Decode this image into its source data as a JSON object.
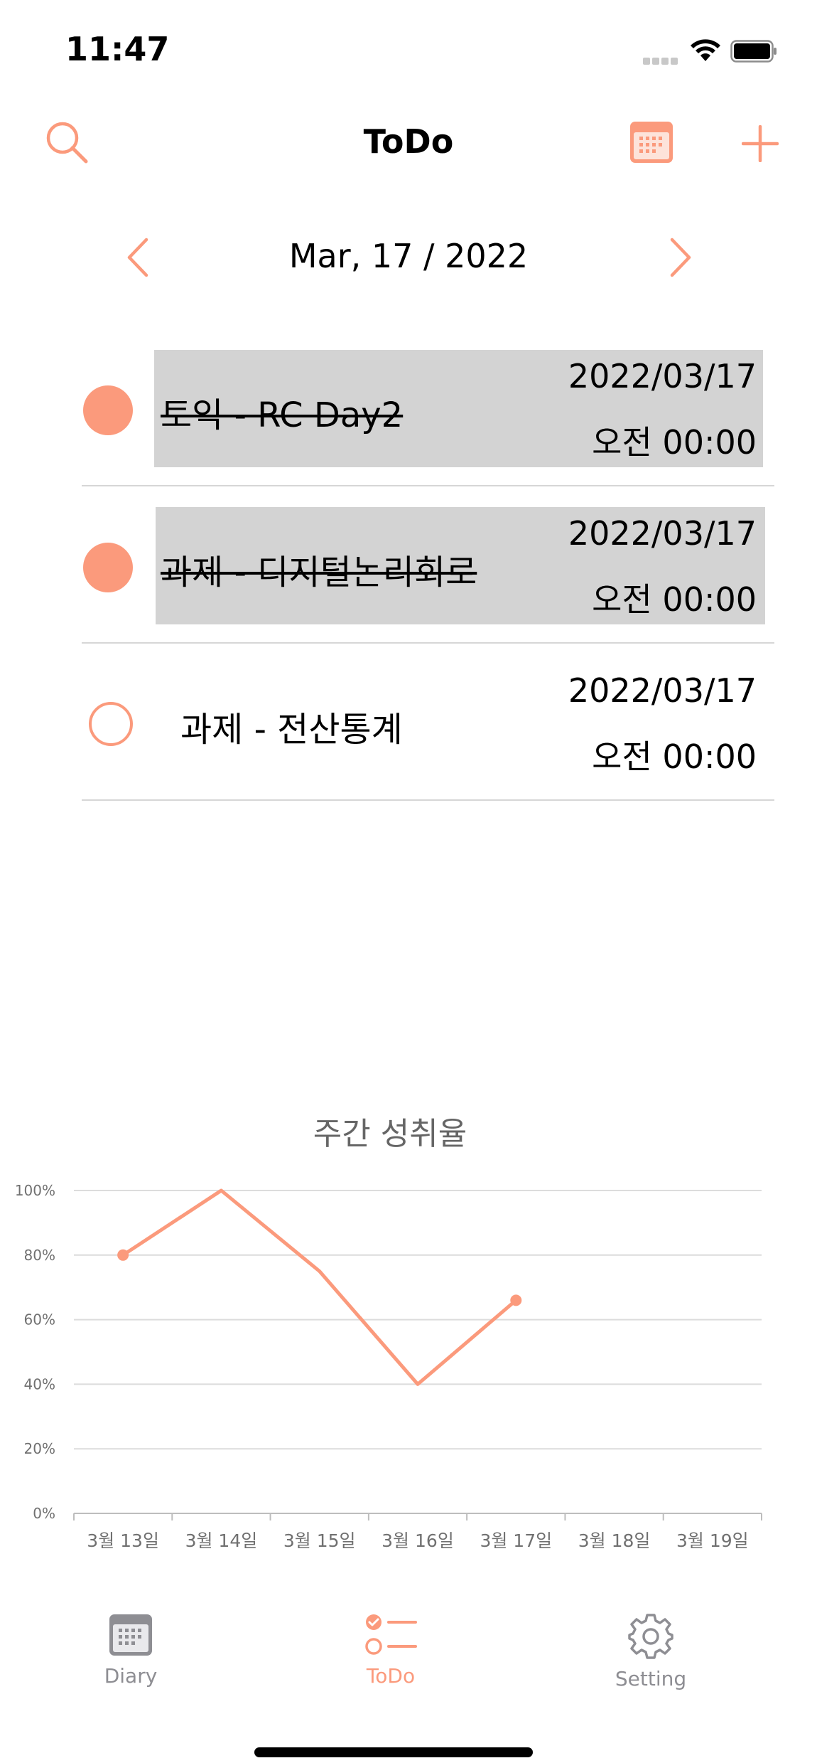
{
  "status_bar": {
    "time": "11:47"
  },
  "nav": {
    "title": "ToDo"
  },
  "date_nav": {
    "current": "Mar, 17 / 2022"
  },
  "todos": [
    {
      "title": "토익 - RC Day2",
      "date": "2022/03/17",
      "time": "오전 00:00",
      "done": true
    },
    {
      "title": "과제 - 디지털논리회로",
      "date": "2022/03/17",
      "time": "오전 00:00",
      "done": true
    },
    {
      "title": "과제 - 전산통계",
      "date": "2022/03/17",
      "time": "오전 00:00",
      "done": false
    }
  ],
  "chart_data": {
    "type": "line",
    "title": "주간 성취율",
    "categories": [
      "3월 13일",
      "3월 14일",
      "3월 15일",
      "3월 16일",
      "3월 17일",
      "3월 18일",
      "3월 19일"
    ],
    "series": [
      {
        "values": [
          80,
          100,
          75,
          40,
          66,
          null,
          null
        ]
      }
    ],
    "yticks": [
      "0%",
      "20%",
      "40%",
      "60%",
      "80%",
      "100%"
    ],
    "ylim": [
      0,
      100
    ],
    "grid": true,
    "color": "#fb9a7c"
  },
  "tabs": [
    {
      "label": "Diary",
      "icon": "calendar-icon",
      "active": false
    },
    {
      "label": "ToDo",
      "icon": "checklist-icon",
      "active": true
    },
    {
      "label": "Setting",
      "icon": "gear-icon",
      "active": false
    }
  ],
  "colors": {
    "accent": "#fb9a7c",
    "inactive": "#8e8e93",
    "highlight": "#d3d3d3"
  }
}
